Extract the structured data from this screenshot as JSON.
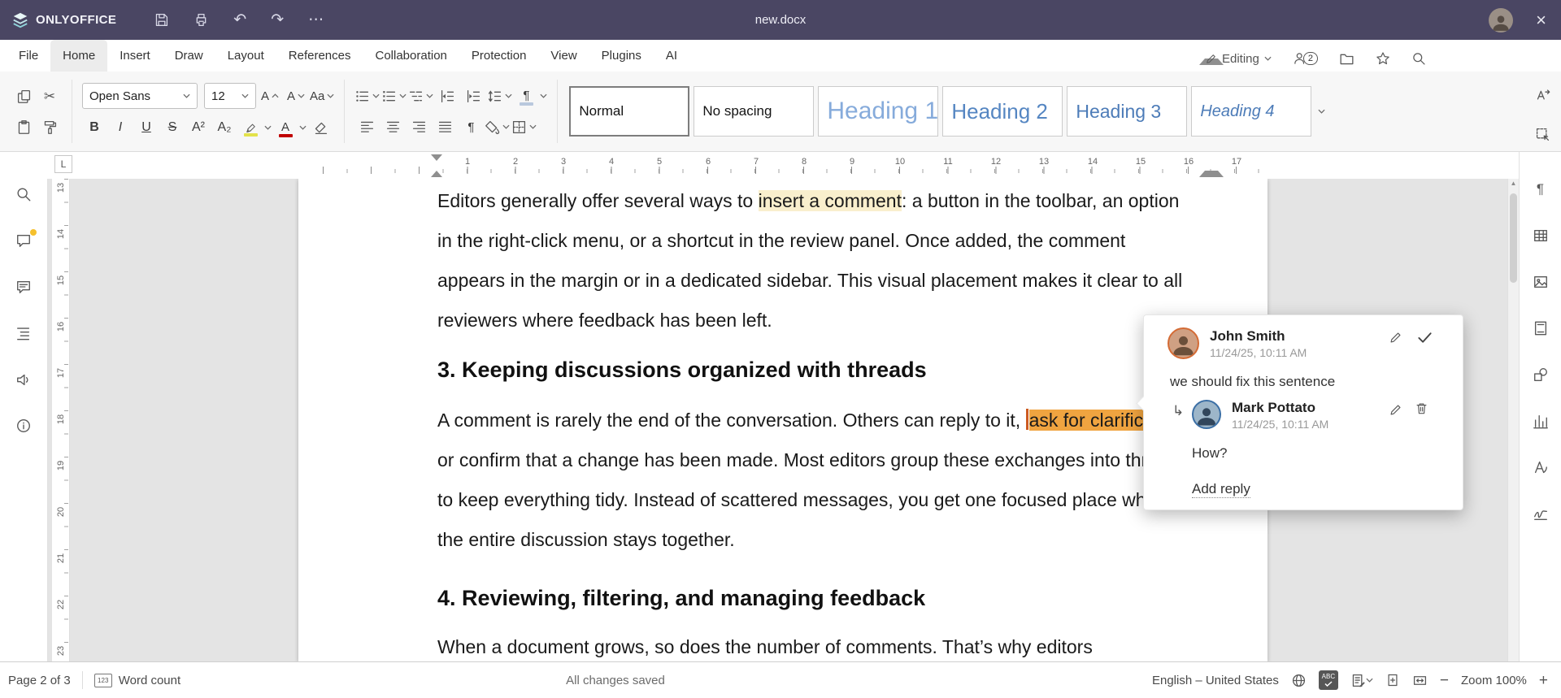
{
  "titlebar": {
    "app_name": "ONLYOFFICE",
    "document_title": "new.docx"
  },
  "menubar": {
    "items": [
      "File",
      "Home",
      "Insert",
      "Draw",
      "Layout",
      "References",
      "Collaboration",
      "Protection",
      "View",
      "Plugins",
      "AI"
    ],
    "active": "Home",
    "editing_label": "Editing",
    "users_count": "2"
  },
  "toolbar": {
    "font_name": "Open Sans",
    "font_size": "12",
    "bold": "B",
    "italic": "I",
    "underline": "U",
    "strikethrough": "S",
    "superscript": "A²",
    "subscript": "A₂",
    "grow_font": "A",
    "shrink_font": "A",
    "case_label": "Aa",
    "font_color_letter": "A",
    "pilcrow": "¶",
    "styles": [
      {
        "label": "Normal"
      },
      {
        "label": "No spacing"
      },
      {
        "label": "Heading 1"
      },
      {
        "label": "Heading 2"
      },
      {
        "label": "Heading 3"
      },
      {
        "label": "Heading 4"
      }
    ]
  },
  "ruler": {
    "corner": "L",
    "h": [
      "1",
      "2",
      "3",
      "4",
      "5",
      "6",
      "7",
      "8",
      "9",
      "10",
      "11",
      "12",
      "13",
      "14",
      "15",
      "16",
      "17"
    ],
    "v": [
      "13",
      "14",
      "15",
      "16",
      "17",
      "18",
      "19",
      "20",
      "21",
      "22",
      "23"
    ]
  },
  "document": {
    "p1_a": "Editors generally offer several ways to ",
    "p1_highlight": "insert a comment",
    "p1_b": ": a button in the toolbar, an option in the right-click menu, or a shortcut in the review panel. Once added, the comment appears in the margin or in a dedicated sidebar. This visual placement makes it clear to all reviewers where feedback has been left.",
    "h3": "3. Keeping discussions organized with threads",
    "p2_a": "A comment is rarely the end of the conversation. Others can reply to it, ",
    "p2_highlight": "ask for clarification",
    "p2_b": ", or confirm that a change has been made. Most editors group these exchanges into threads to keep everything tidy. Instead of scattered messages, you get one focused place where the entire discussion stays together.",
    "h4": "4. Reviewing, filtering, and managing feedback",
    "p3": "When a document grows, so does the number of comments. That’s why editors"
  },
  "comment_popup": {
    "author": "John Smith",
    "timestamp": "11/24/25, 10:11 AM",
    "text": "we should fix this sentence",
    "reply": {
      "author": "Mark Pottato",
      "timestamp": "11/24/25, 10:11 AM",
      "text": "How?"
    },
    "add_reply_label": "Add reply"
  },
  "statusbar": {
    "page_indicator": "Page 2 of 3",
    "word_count_icon": "123",
    "word_count_label": "Word count",
    "autosave_status": "All changes saved",
    "language": "English – United States",
    "spell_label": "ABC",
    "zoom_out": "−",
    "zoom_label": "Zoom 100%",
    "zoom_in": "+"
  },
  "colors": {
    "titlebar_bg": "#4a4663",
    "comment_highlight_inactive": "#f9efcd",
    "comment_highlight_active": "#f0a440",
    "heading_style_blue": "#5586c2",
    "notification_dot": "#f5c02c",
    "font_color_bar": "#c00000",
    "highlighter_bar": "#e3e24b"
  }
}
